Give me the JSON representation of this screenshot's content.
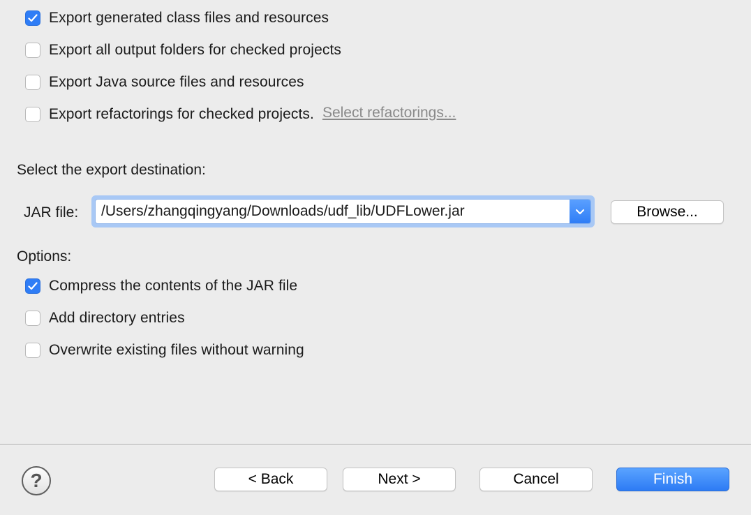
{
  "export_options": [
    {
      "label": "Export generated class files and resources",
      "checked": true
    },
    {
      "label": "Export all output folders for checked projects",
      "checked": false
    },
    {
      "label": "Export Java source files and resources",
      "checked": false
    },
    {
      "label": "Export refactorings for checked projects.",
      "checked": false
    }
  ],
  "select_refactorings_link": "Select refactorings...",
  "destination": {
    "heading": "Select the export destination:",
    "jar_label": "JAR file:",
    "jar_path": "/Users/zhangqingyang/Downloads/udf_lib/UDFLower.jar",
    "browse_label": "Browse..."
  },
  "options": {
    "heading": "Options:",
    "items": [
      {
        "label": "Compress the contents of the JAR file",
        "checked": true
      },
      {
        "label": "Add directory entries",
        "checked": false
      },
      {
        "label": "Overwrite existing files without warning",
        "checked": false
      }
    ]
  },
  "footer": {
    "help_glyph": "?",
    "back_label": "< Back",
    "next_label": "Next >",
    "cancel_label": "Cancel",
    "finish_label": "Finish"
  },
  "colors": {
    "accent": "#2f7df6",
    "background": "#ececec",
    "link": "#8a8a8a"
  }
}
